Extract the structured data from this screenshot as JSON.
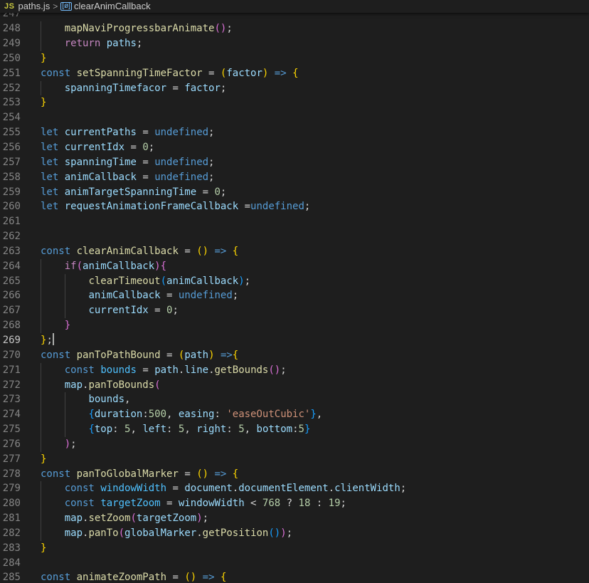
{
  "breadcrumb": {
    "file_icon": "JS",
    "file": "paths.js",
    "separator": ">",
    "symbol_icon": "[ø]",
    "symbol": "clearAnimCallback"
  },
  "editor": {
    "cursor_line": 269,
    "lines": [
      {
        "n": "247",
        "indent": 0,
        "tokens": []
      },
      {
        "n": "248",
        "indent": 1,
        "tokens": [
          [
            "fn",
            "mapNaviProgressbarAnimate"
          ],
          [
            "p2",
            "("
          ],
          [
            "p2",
            ")"
          ],
          [
            "op",
            ";"
          ]
        ]
      },
      {
        "n": "249",
        "indent": 1,
        "tokens": [
          [
            "ctl",
            "return"
          ],
          [
            "op",
            " "
          ],
          [
            "var",
            "paths"
          ],
          [
            "op",
            ";"
          ]
        ]
      },
      {
        "n": "250",
        "indent": 0,
        "tokens": [
          [
            "p1",
            "}"
          ]
        ]
      },
      {
        "n": "251",
        "indent": 0,
        "tokens": [
          [
            "kw",
            "const"
          ],
          [
            "op",
            " "
          ],
          [
            "fn",
            "setSpanningTimeFactor"
          ],
          [
            "op",
            " = "
          ],
          [
            "p1",
            "("
          ],
          [
            "var",
            "factor"
          ],
          [
            "p1",
            ")"
          ],
          [
            "op",
            " "
          ],
          [
            "kw",
            "=>"
          ],
          [
            "op",
            " "
          ],
          [
            "p1",
            "{"
          ]
        ]
      },
      {
        "n": "252",
        "indent": 1,
        "tokens": [
          [
            "var",
            "spanningTimefacor"
          ],
          [
            "op",
            " = "
          ],
          [
            "var",
            "factor"
          ],
          [
            "op",
            ";"
          ]
        ]
      },
      {
        "n": "253",
        "indent": 0,
        "tokens": [
          [
            "p1",
            "}"
          ]
        ]
      },
      {
        "n": "254",
        "indent": 0,
        "tokens": []
      },
      {
        "n": "255",
        "indent": 0,
        "tokens": [
          [
            "kw",
            "let"
          ],
          [
            "op",
            " "
          ],
          [
            "var",
            "currentPaths"
          ],
          [
            "op",
            " = "
          ],
          [
            "kw",
            "undefined"
          ],
          [
            "op",
            ";"
          ]
        ]
      },
      {
        "n": "256",
        "indent": 0,
        "tokens": [
          [
            "kw",
            "let"
          ],
          [
            "op",
            " "
          ],
          [
            "var",
            "currentIdx"
          ],
          [
            "op",
            " = "
          ],
          [
            "num",
            "0"
          ],
          [
            "op",
            ";"
          ]
        ]
      },
      {
        "n": "257",
        "indent": 0,
        "tokens": [
          [
            "kw",
            "let"
          ],
          [
            "op",
            " "
          ],
          [
            "var",
            "spanningTime"
          ],
          [
            "op",
            " = "
          ],
          [
            "kw",
            "undefined"
          ],
          [
            "op",
            ";"
          ]
        ]
      },
      {
        "n": "258",
        "indent": 0,
        "tokens": [
          [
            "kw",
            "let"
          ],
          [
            "op",
            " "
          ],
          [
            "var",
            "animCallback"
          ],
          [
            "op",
            " = "
          ],
          [
            "kw",
            "undefined"
          ],
          [
            "op",
            ";"
          ]
        ]
      },
      {
        "n": "259",
        "indent": 0,
        "tokens": [
          [
            "kw",
            "let"
          ],
          [
            "op",
            " "
          ],
          [
            "var",
            "animTargetSpanningTime"
          ],
          [
            "op",
            " = "
          ],
          [
            "num",
            "0"
          ],
          [
            "op",
            ";"
          ]
        ]
      },
      {
        "n": "260",
        "indent": 0,
        "tokens": [
          [
            "kw",
            "let"
          ],
          [
            "op",
            " "
          ],
          [
            "var",
            "requestAnimationFrameCallback"
          ],
          [
            "op",
            " ="
          ],
          [
            "kw",
            "undefined"
          ],
          [
            "op",
            ";"
          ]
        ]
      },
      {
        "n": "261",
        "indent": 0,
        "tokens": []
      },
      {
        "n": "262",
        "indent": 0,
        "tokens": []
      },
      {
        "n": "263",
        "indent": 0,
        "tokens": [
          [
            "kw",
            "const"
          ],
          [
            "op",
            " "
          ],
          [
            "fn",
            "clearAnimCallback"
          ],
          [
            "op",
            " = "
          ],
          [
            "p1",
            "("
          ],
          [
            "p1",
            ")"
          ],
          [
            "op",
            " "
          ],
          [
            "kw",
            "=>"
          ],
          [
            "op",
            " "
          ],
          [
            "p1",
            "{"
          ]
        ]
      },
      {
        "n": "264",
        "indent": 1,
        "tokens": [
          [
            "ctl",
            "if"
          ],
          [
            "p2",
            "("
          ],
          [
            "var",
            "animCallback"
          ],
          [
            "p2",
            ")"
          ],
          [
            "p2",
            "{"
          ]
        ]
      },
      {
        "n": "265",
        "indent": 2,
        "tokens": [
          [
            "fn",
            "clearTimeout"
          ],
          [
            "p3",
            "("
          ],
          [
            "var",
            "animCallback"
          ],
          [
            "p3",
            ")"
          ],
          [
            "op",
            ";"
          ]
        ]
      },
      {
        "n": "266",
        "indent": 2,
        "tokens": [
          [
            "var",
            "animCallback"
          ],
          [
            "op",
            " = "
          ],
          [
            "kw",
            "undefined"
          ],
          [
            "op",
            ";"
          ]
        ]
      },
      {
        "n": "267",
        "indent": 2,
        "tokens": [
          [
            "var",
            "currentIdx"
          ],
          [
            "op",
            " = "
          ],
          [
            "num",
            "0"
          ],
          [
            "op",
            ";"
          ]
        ]
      },
      {
        "n": "268",
        "indent": 1,
        "tokens": [
          [
            "p2",
            "}"
          ]
        ]
      },
      {
        "n": "269",
        "indent": 0,
        "tokens": [
          [
            "p1",
            "}"
          ],
          [
            "op",
            ";"
          ]
        ],
        "cursor": true
      },
      {
        "n": "270",
        "indent": 0,
        "tokens": [
          [
            "kw",
            "const"
          ],
          [
            "op",
            " "
          ],
          [
            "fn",
            "panToPathBound"
          ],
          [
            "op",
            " = "
          ],
          [
            "p1",
            "("
          ],
          [
            "var",
            "path"
          ],
          [
            "p1",
            ")"
          ],
          [
            "op",
            " "
          ],
          [
            "kw",
            "=>"
          ],
          [
            "p1",
            "{"
          ]
        ]
      },
      {
        "n": "271",
        "indent": 1,
        "tokens": [
          [
            "kw",
            "const"
          ],
          [
            "op",
            " "
          ],
          [
            "const",
            "bounds"
          ],
          [
            "op",
            " = "
          ],
          [
            "var",
            "path"
          ],
          [
            "op",
            "."
          ],
          [
            "var",
            "line"
          ],
          [
            "op",
            "."
          ],
          [
            "fn",
            "getBounds"
          ],
          [
            "p2",
            "("
          ],
          [
            "p2",
            ")"
          ],
          [
            "op",
            ";"
          ]
        ]
      },
      {
        "n": "272",
        "indent": 1,
        "tokens": [
          [
            "var",
            "map"
          ],
          [
            "op",
            "."
          ],
          [
            "fn",
            "panToBounds"
          ],
          [
            "p2",
            "("
          ]
        ]
      },
      {
        "n": "273",
        "indent": 2,
        "tokens": [
          [
            "var",
            "bounds"
          ],
          [
            "op",
            ","
          ]
        ]
      },
      {
        "n": "274",
        "indent": 2,
        "tokens": [
          [
            "p3",
            "{"
          ],
          [
            "var",
            "duration"
          ],
          [
            "op",
            ":"
          ],
          [
            "num",
            "500"
          ],
          [
            "op",
            ", "
          ],
          [
            "var",
            "easing"
          ],
          [
            "op",
            ": "
          ],
          [
            "str",
            "'easeOutCubic'"
          ],
          [
            "p3",
            "}"
          ],
          [
            "op",
            ","
          ]
        ]
      },
      {
        "n": "275",
        "indent": 2,
        "tokens": [
          [
            "p3",
            "{"
          ],
          [
            "var",
            "top"
          ],
          [
            "op",
            ": "
          ],
          [
            "num",
            "5"
          ],
          [
            "op",
            ", "
          ],
          [
            "var",
            "left"
          ],
          [
            "op",
            ": "
          ],
          [
            "num",
            "5"
          ],
          [
            "op",
            ", "
          ],
          [
            "var",
            "right"
          ],
          [
            "op",
            ": "
          ],
          [
            "num",
            "5"
          ],
          [
            "op",
            ", "
          ],
          [
            "var",
            "bottom"
          ],
          [
            "op",
            ":"
          ],
          [
            "num",
            "5"
          ],
          [
            "p3",
            "}"
          ]
        ]
      },
      {
        "n": "276",
        "indent": 1,
        "tokens": [
          [
            "p2",
            ")"
          ],
          [
            "op",
            ";"
          ]
        ]
      },
      {
        "n": "277",
        "indent": 0,
        "tokens": [
          [
            "p1",
            "}"
          ]
        ]
      },
      {
        "n": "278",
        "indent": 0,
        "tokens": [
          [
            "kw",
            "const"
          ],
          [
            "op",
            " "
          ],
          [
            "fn",
            "panToGlobalMarker"
          ],
          [
            "op",
            " = "
          ],
          [
            "p1",
            "("
          ],
          [
            "p1",
            ")"
          ],
          [
            "op",
            " "
          ],
          [
            "kw",
            "=>"
          ],
          [
            "op",
            " "
          ],
          [
            "p1",
            "{"
          ]
        ]
      },
      {
        "n": "279",
        "indent": 1,
        "tokens": [
          [
            "kw",
            "const"
          ],
          [
            "op",
            " "
          ],
          [
            "const",
            "windowWidth"
          ],
          [
            "op",
            " = "
          ],
          [
            "var",
            "document"
          ],
          [
            "op",
            "."
          ],
          [
            "var",
            "documentElement"
          ],
          [
            "op",
            "."
          ],
          [
            "var",
            "clientWidth"
          ],
          [
            "op",
            ";"
          ]
        ]
      },
      {
        "n": "280",
        "indent": 1,
        "tokens": [
          [
            "kw",
            "const"
          ],
          [
            "op",
            " "
          ],
          [
            "const",
            "targetZoom"
          ],
          [
            "op",
            " = "
          ],
          [
            "var",
            "windowWidth"
          ],
          [
            "op",
            " < "
          ],
          [
            "num",
            "768"
          ],
          [
            "op",
            " ? "
          ],
          [
            "num",
            "18"
          ],
          [
            "op",
            " : "
          ],
          [
            "num",
            "19"
          ],
          [
            "op",
            ";"
          ]
        ]
      },
      {
        "n": "281",
        "indent": 1,
        "tokens": [
          [
            "var",
            "map"
          ],
          [
            "op",
            "."
          ],
          [
            "fn",
            "setZoom"
          ],
          [
            "p2",
            "("
          ],
          [
            "var",
            "targetZoom"
          ],
          [
            "p2",
            ")"
          ],
          [
            "op",
            ";"
          ]
        ]
      },
      {
        "n": "282",
        "indent": 1,
        "tokens": [
          [
            "var",
            "map"
          ],
          [
            "op",
            "."
          ],
          [
            "fn",
            "panTo"
          ],
          [
            "p2",
            "("
          ],
          [
            "var",
            "globalMarker"
          ],
          [
            "op",
            "."
          ],
          [
            "fn",
            "getPosition"
          ],
          [
            "p3",
            "("
          ],
          [
            "p3",
            ")"
          ],
          [
            "p2",
            ")"
          ],
          [
            "op",
            ";"
          ]
        ]
      },
      {
        "n": "283",
        "indent": 0,
        "tokens": [
          [
            "p1",
            "}"
          ]
        ]
      },
      {
        "n": "284",
        "indent": 0,
        "tokens": []
      },
      {
        "n": "285",
        "indent": 0,
        "tokens": [
          [
            "kw",
            "const"
          ],
          [
            "op",
            " "
          ],
          [
            "fn",
            "animateZoomPath"
          ],
          [
            "op",
            " = "
          ],
          [
            "p1",
            "("
          ],
          [
            "p1",
            ")"
          ],
          [
            "op",
            " "
          ],
          [
            "kw",
            "=>"
          ],
          [
            "op",
            " "
          ],
          [
            "p1",
            "{"
          ]
        ]
      }
    ]
  }
}
